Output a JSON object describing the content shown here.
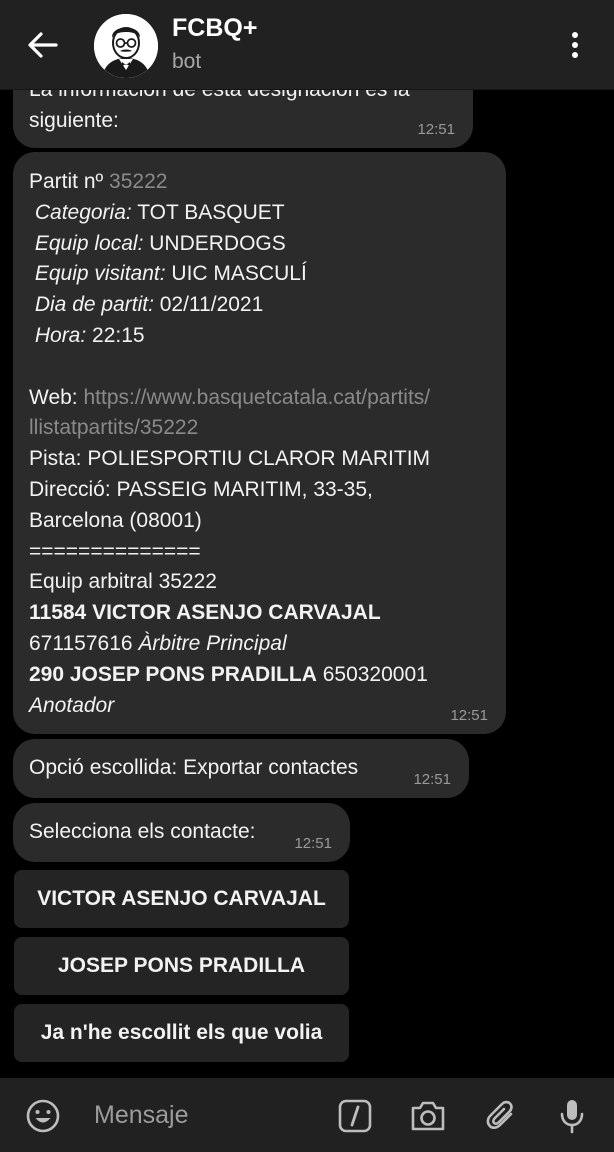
{
  "header": {
    "title": "FCBQ+",
    "subtitle": "bot"
  },
  "messages": {
    "m1": {
      "line1": "La información de esta designación es la",
      "line2": "siguiente:",
      "time": "12:51"
    },
    "m2": {
      "partit_label": "Partit nº ",
      "partit_num": "35222",
      "categoria_label": "Categoria:",
      "categoria_value": " TOT BASQUET",
      "local_label": "Equip local:",
      "local_value": " UNDERDOGS",
      "visitant_label": "Equip visitant:",
      "visitant_value": " UIC MASCULÍ",
      "dia_label": "Dia de partit:",
      "dia_value": " 02/11/2021",
      "hora_label": "Hora:",
      "hora_value": " 22:15",
      "web_label": "Web: ",
      "web_url_1": "https://www.basquetcatala.cat/partits/",
      "web_url_2": "llistatpartits/35222",
      "pista": "Pista:  POLIESPORTIU CLAROR MARITIM",
      "direccio_1": "Direcció: PASSEIG MARITIM, 33-35,",
      "direccio_2": "Barcelona (08001)",
      "separator": "==============",
      "equip_arbitral": "Equip arbitral 35222",
      "ref1_name": "11584 VICTOR ASENJO CARVAJAL",
      "ref1_phone": "671157616 ",
      "ref1_role": "Àrbitre Principal",
      "ref2_name": "290 JOSEP PONS PRADILLA",
      "ref2_phone": "  650320001",
      "ref2_role": "Anotador",
      "time": "12:51"
    },
    "m3": {
      "text": "Opció escollida:  Exportar contactes",
      "time": "12:51"
    },
    "m4": {
      "text": "Selecciona els contacte:",
      "time": "12:51"
    }
  },
  "keyboard": {
    "btn1": "VICTOR ASENJO CARVAJAL",
    "btn2": "JOSEP PONS PRADILLA",
    "btn3": "Ja n'he escollit els que volia"
  },
  "input": {
    "placeholder": "Mensaje",
    "value": ""
  },
  "icons": {
    "back": "arrow-back-icon",
    "menu": "more-vert-icon",
    "emoji": "emoji-icon",
    "commands": "slash-command-icon",
    "camera": "camera-icon",
    "attach": "paperclip-icon",
    "mic": "microphone-icon"
  },
  "colors": {
    "background": "#000000",
    "header": "#212121",
    "bubble": "#2b2b2b",
    "keyboard_button": "#242424",
    "text": "#f2f2f2",
    "muted": "#9a9a9a",
    "link": "#8a8a8a"
  }
}
